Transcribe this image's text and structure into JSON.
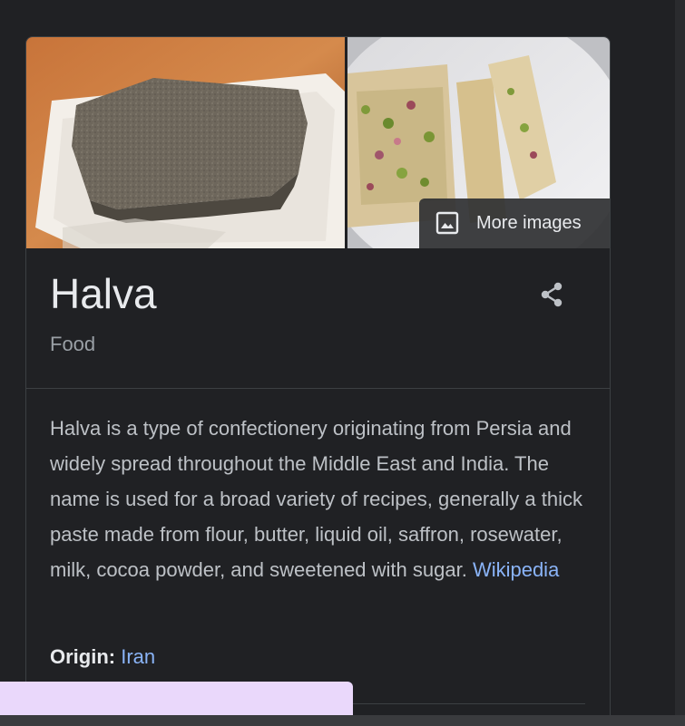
{
  "knowledge_panel": {
    "images": [
      {
        "description_icon": "halva-block-image"
      },
      {
        "description_icon": "halva-slices-image"
      }
    ],
    "more_images_label": "More images",
    "title": "Halva",
    "subtitle": "Food",
    "description_text": "Halva is a type of confectionery originating from Persia and widely spread throughout the Middle East and India. The name is used for a broad variety of recipes, generally a thick paste made from flour, butter, liquid oil, saffron, rosewater, milk, cocoa powder, and sweetened with sugar. ",
    "source_link": "Wikipedia",
    "origin_label": "Origin:",
    "origin_value": "Iran"
  },
  "colors": {
    "background": "#202124",
    "text_primary": "#e8eaed",
    "text_secondary": "#9aa0a6",
    "link": "#8ab4f8",
    "overlay": "#ead8fb"
  },
  "icons": {
    "more_images": "image-icon",
    "share": "share-icon"
  }
}
